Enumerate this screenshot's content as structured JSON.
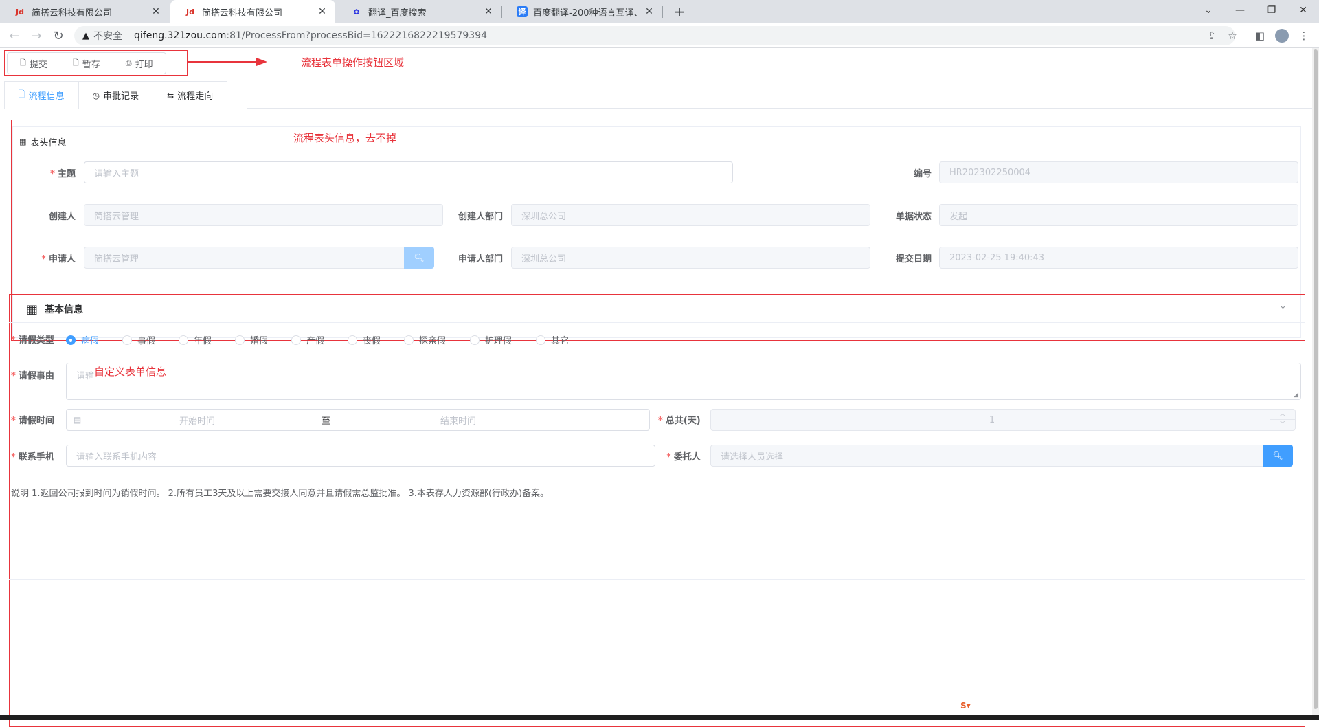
{
  "browser": {
    "tabs": [
      {
        "title": "简搭云科技有限公司",
        "favicon": "jd-logo-icon",
        "active": false
      },
      {
        "title": "简搭云科技有限公司",
        "favicon": "jd-logo-icon",
        "active": true
      },
      {
        "title": "翻译_百度搜索",
        "favicon": "baidu-paw-icon",
        "active": false
      },
      {
        "title": "百度翻译-200种语言互译、沟通全",
        "favicon": "translate-icon",
        "active": false
      }
    ],
    "new_tab": "+",
    "address": {
      "security_label": "不安全",
      "host": "qifeng.321zou.com",
      "path": ":81/ProcessFrom?processBid=1622216822219579394"
    }
  },
  "toolbar": {
    "submit": "提交",
    "save_draft": "暂存",
    "print": "打印"
  },
  "annotations": {
    "toolbar_note": "流程表单操作按钮区域",
    "header_note": "流程表头信息，去不掉",
    "custom_note": "自定义表单信息"
  },
  "tabs": {
    "process_info": "流程信息",
    "approval_records": "审批记录",
    "process_flow": "流程走向"
  },
  "header_section": {
    "title": "表头信息",
    "subject_label": "主题",
    "subject_placeholder": "请输入主题",
    "number_label": "编号",
    "number_value": "HR202302250004",
    "creator_label": "创建人",
    "creator_value": "简搭云管理",
    "creator_dept_label": "创建人部门",
    "creator_dept_value": "深圳总公司",
    "doc_status_label": "单据状态",
    "doc_status_value": "发起",
    "applicant_label": "申请人",
    "applicant_value": "简搭云管理",
    "applicant_dept_label": "申请人部门",
    "applicant_dept_value": "深圳总公司",
    "submit_date_label": "提交日期",
    "submit_date_value": "2023-02-25 19:40:43"
  },
  "basic_section": {
    "title": "基本信息",
    "leave_type_label": "请假类型",
    "leave_types": [
      "病假",
      "事假",
      "年假",
      "婚假",
      "产假",
      "丧假",
      "探亲假",
      "护理假",
      "其它"
    ],
    "selected_leave_type": "病假",
    "reason_label": "请假事由",
    "reason_placeholder": "请输",
    "time_label": "请假时间",
    "start_placeholder": "开始时间",
    "range_sep": "至",
    "end_placeholder": "结束时间",
    "total_label": "总共(天)",
    "total_value": "1",
    "phone_label": "联系手机",
    "phone_placeholder": "请输入联系手机内容",
    "delegate_label": "委托人",
    "delegate_placeholder": "请选择人员选择",
    "note": "说明 1.返回公司报到时间为销假时间。 2.所有员工3天及以上需要交接人同意并且请假需总监批准。 3.本表存人力资源部(行政办)备案。"
  },
  "colors": {
    "primary": "#409eff",
    "primary_light": "#a0cfff",
    "annotation_red": "#e8343c",
    "required_red": "#f56c6c"
  }
}
